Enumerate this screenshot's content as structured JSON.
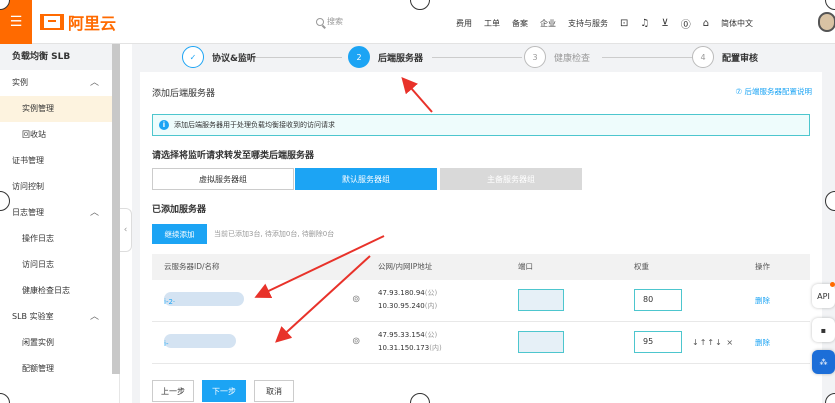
{
  "topbar": {
    "menu_icon": "☰",
    "logo_text": "阿里云",
    "search_placeholder": "搜索",
    "nav": [
      "费用",
      "工单",
      "备案",
      "企业",
      "支持与服务"
    ],
    "lang": "简体中文"
  },
  "sidebar": {
    "title": "负载均衡 SLB",
    "items": [
      {
        "label": "实例",
        "caret": "︿",
        "sub": false,
        "active": false
      },
      {
        "label": "实例管理",
        "sub": true,
        "active": true
      },
      {
        "label": "回收站",
        "sub": true,
        "active": false
      },
      {
        "label": "证书管理",
        "sub": false,
        "active": false
      },
      {
        "label": "访问控制",
        "sub": false,
        "active": false
      },
      {
        "label": "日志管理",
        "caret": "︿",
        "sub": false,
        "active": false
      },
      {
        "label": "操作日志",
        "sub": true,
        "active": false
      },
      {
        "label": "访问日志",
        "sub": true,
        "active": false
      },
      {
        "label": "健康检查日志",
        "sub": true,
        "active": false
      },
      {
        "label": "SLB 实验室",
        "caret": "︿",
        "sub": false,
        "active": false
      },
      {
        "label": "闲置实例",
        "sub": true,
        "active": false
      },
      {
        "label": "配额管理",
        "sub": true,
        "active": false
      }
    ]
  },
  "stepper": {
    "steps": [
      {
        "num": "✓",
        "label": "协议&监听",
        "state": "done"
      },
      {
        "num": "2",
        "label": "后端服务器",
        "state": "active"
      },
      {
        "num": "3",
        "label": "健康检查",
        "state": "todo"
      },
      {
        "num": "4",
        "label": "配置审核",
        "state": "todo"
      }
    ]
  },
  "panel": {
    "title": "添加后端服务器",
    "help_link": "⑦ 后端服务器配置说明",
    "info": "添加后端服务器用于处理负载均衡接收到的访问请求",
    "question": "请选择将监听请求转发至哪类后端服务器",
    "segments": [
      "虚拟服务器组",
      "默认服务器组",
      "主备服务器组"
    ],
    "added_title": "已添加服务器",
    "add_button": "继续添加",
    "add_hint": "当前已添加3台, 待添加0台, 待删除0台",
    "columns": [
      "云服务器ID/名称",
      "公网/内网IP地址",
      "端口",
      "权重",
      "操作"
    ],
    "rows": [
      {
        "id": "i-2·",
        "ip_public": "47.93.180.94",
        "ip_private": "10.30.95.240",
        "public_tag": "(公)",
        "private_tag": "(内)",
        "weight": "80",
        "adjust": "",
        "delete": "删除"
      },
      {
        "id": "i-",
        "ip_public": "47.95.33.154",
        "ip_private": "10.31.150.173",
        "public_tag": "(公)",
        "private_tag": "(内)",
        "weight": "95",
        "adjust": "↓↑↑↓ ×",
        "delete": "删除"
      }
    ],
    "buttons": {
      "prev": "上一步",
      "next": "下一步",
      "cancel": "取消"
    }
  },
  "floating": {
    "api": "API",
    "msg": "▪",
    "grid": "⁂"
  },
  "colors": {
    "brand": "#ff6a00",
    "primary": "#1ca4f4",
    "annotation": "#e8322a"
  }
}
